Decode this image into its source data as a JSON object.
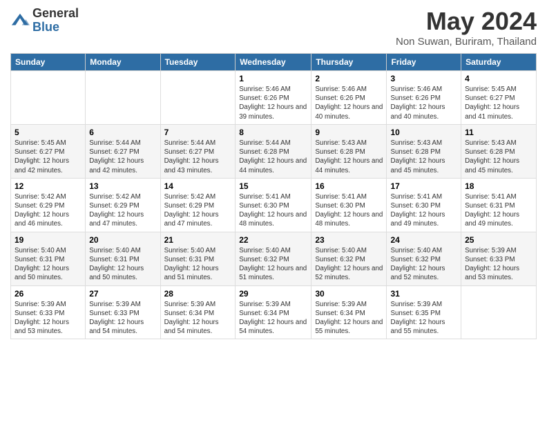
{
  "header": {
    "logo_general": "General",
    "logo_blue": "Blue",
    "month_year": "May 2024",
    "location": "Non Suwan, Buriram, Thailand"
  },
  "weekdays": [
    "Sunday",
    "Monday",
    "Tuesday",
    "Wednesday",
    "Thursday",
    "Friday",
    "Saturday"
  ],
  "weeks": [
    [
      {
        "day": "",
        "info": ""
      },
      {
        "day": "",
        "info": ""
      },
      {
        "day": "",
        "info": ""
      },
      {
        "day": "1",
        "info": "Sunrise: 5:46 AM\nSunset: 6:26 PM\nDaylight: 12 hours and 39 minutes."
      },
      {
        "day": "2",
        "info": "Sunrise: 5:46 AM\nSunset: 6:26 PM\nDaylight: 12 hours and 40 minutes."
      },
      {
        "day": "3",
        "info": "Sunrise: 5:46 AM\nSunset: 6:26 PM\nDaylight: 12 hours and 40 minutes."
      },
      {
        "day": "4",
        "info": "Sunrise: 5:45 AM\nSunset: 6:27 PM\nDaylight: 12 hours and 41 minutes."
      }
    ],
    [
      {
        "day": "5",
        "info": "Sunrise: 5:45 AM\nSunset: 6:27 PM\nDaylight: 12 hours and 42 minutes."
      },
      {
        "day": "6",
        "info": "Sunrise: 5:44 AM\nSunset: 6:27 PM\nDaylight: 12 hours and 42 minutes."
      },
      {
        "day": "7",
        "info": "Sunrise: 5:44 AM\nSunset: 6:27 PM\nDaylight: 12 hours and 43 minutes."
      },
      {
        "day": "8",
        "info": "Sunrise: 5:44 AM\nSunset: 6:28 PM\nDaylight: 12 hours and 44 minutes."
      },
      {
        "day": "9",
        "info": "Sunrise: 5:43 AM\nSunset: 6:28 PM\nDaylight: 12 hours and 44 minutes."
      },
      {
        "day": "10",
        "info": "Sunrise: 5:43 AM\nSunset: 6:28 PM\nDaylight: 12 hours and 45 minutes."
      },
      {
        "day": "11",
        "info": "Sunrise: 5:43 AM\nSunset: 6:28 PM\nDaylight: 12 hours and 45 minutes."
      }
    ],
    [
      {
        "day": "12",
        "info": "Sunrise: 5:42 AM\nSunset: 6:29 PM\nDaylight: 12 hours and 46 minutes."
      },
      {
        "day": "13",
        "info": "Sunrise: 5:42 AM\nSunset: 6:29 PM\nDaylight: 12 hours and 47 minutes."
      },
      {
        "day": "14",
        "info": "Sunrise: 5:42 AM\nSunset: 6:29 PM\nDaylight: 12 hours and 47 minutes."
      },
      {
        "day": "15",
        "info": "Sunrise: 5:41 AM\nSunset: 6:30 PM\nDaylight: 12 hours and 48 minutes."
      },
      {
        "day": "16",
        "info": "Sunrise: 5:41 AM\nSunset: 6:30 PM\nDaylight: 12 hours and 48 minutes."
      },
      {
        "day": "17",
        "info": "Sunrise: 5:41 AM\nSunset: 6:30 PM\nDaylight: 12 hours and 49 minutes."
      },
      {
        "day": "18",
        "info": "Sunrise: 5:41 AM\nSunset: 6:31 PM\nDaylight: 12 hours and 49 minutes."
      }
    ],
    [
      {
        "day": "19",
        "info": "Sunrise: 5:40 AM\nSunset: 6:31 PM\nDaylight: 12 hours and 50 minutes."
      },
      {
        "day": "20",
        "info": "Sunrise: 5:40 AM\nSunset: 6:31 PM\nDaylight: 12 hours and 50 minutes."
      },
      {
        "day": "21",
        "info": "Sunrise: 5:40 AM\nSunset: 6:31 PM\nDaylight: 12 hours and 51 minutes."
      },
      {
        "day": "22",
        "info": "Sunrise: 5:40 AM\nSunset: 6:32 PM\nDaylight: 12 hours and 51 minutes."
      },
      {
        "day": "23",
        "info": "Sunrise: 5:40 AM\nSunset: 6:32 PM\nDaylight: 12 hours and 52 minutes."
      },
      {
        "day": "24",
        "info": "Sunrise: 5:40 AM\nSunset: 6:32 PM\nDaylight: 12 hours and 52 minutes."
      },
      {
        "day": "25",
        "info": "Sunrise: 5:39 AM\nSunset: 6:33 PM\nDaylight: 12 hours and 53 minutes."
      }
    ],
    [
      {
        "day": "26",
        "info": "Sunrise: 5:39 AM\nSunset: 6:33 PM\nDaylight: 12 hours and 53 minutes."
      },
      {
        "day": "27",
        "info": "Sunrise: 5:39 AM\nSunset: 6:33 PM\nDaylight: 12 hours and 54 minutes."
      },
      {
        "day": "28",
        "info": "Sunrise: 5:39 AM\nSunset: 6:34 PM\nDaylight: 12 hours and 54 minutes."
      },
      {
        "day": "29",
        "info": "Sunrise: 5:39 AM\nSunset: 6:34 PM\nDaylight: 12 hours and 54 minutes."
      },
      {
        "day": "30",
        "info": "Sunrise: 5:39 AM\nSunset: 6:34 PM\nDaylight: 12 hours and 55 minutes."
      },
      {
        "day": "31",
        "info": "Sunrise: 5:39 AM\nSunset: 6:35 PM\nDaylight: 12 hours and 55 minutes."
      },
      {
        "day": "",
        "info": ""
      }
    ]
  ]
}
